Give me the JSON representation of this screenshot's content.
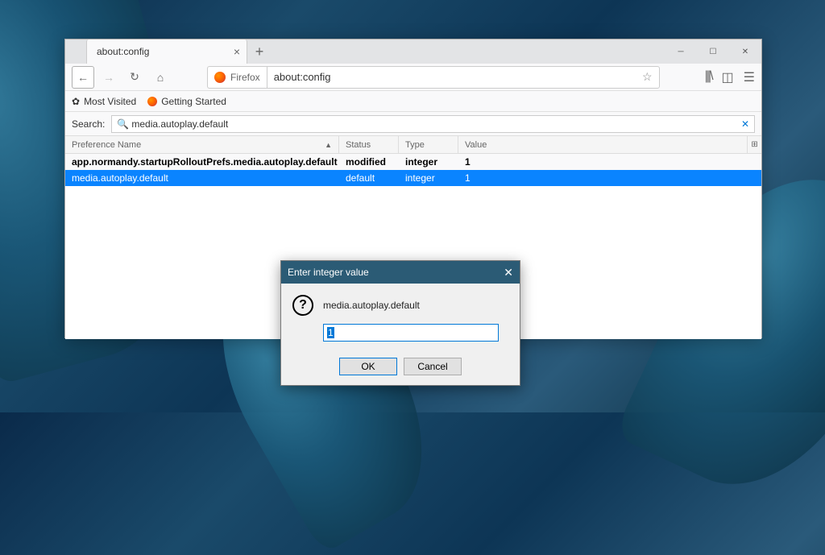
{
  "tab": {
    "title": "about:config"
  },
  "navbar": {
    "identity_label": "Firefox",
    "url": "about:config"
  },
  "bookmarks": {
    "most_visited": "Most Visited",
    "getting_started": "Getting Started"
  },
  "search": {
    "label": "Search:",
    "value": "media.autoplay.default"
  },
  "columns": {
    "name": "Preference Name",
    "status": "Status",
    "type": "Type",
    "value": "Value"
  },
  "rows": [
    {
      "name": "app.normandy.startupRolloutPrefs.media.autoplay.default",
      "status": "modified",
      "type": "integer",
      "value": "1"
    },
    {
      "name": "media.autoplay.default",
      "status": "default",
      "type": "integer",
      "value": "1"
    }
  ],
  "dialog": {
    "title": "Enter integer value",
    "pref": "media.autoplay.default",
    "input": "1",
    "ok": "OK",
    "cancel": "Cancel"
  }
}
